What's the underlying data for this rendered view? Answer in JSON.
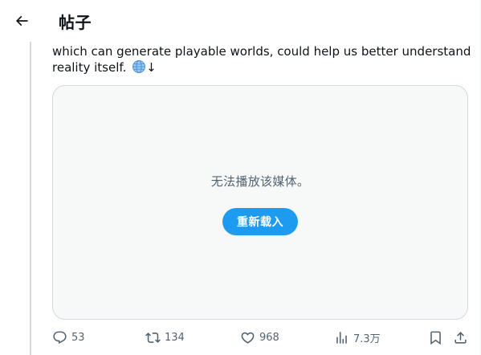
{
  "header": {
    "title": "帖子",
    "back_icon": "arrow-left-icon"
  },
  "tweet": {
    "text_line1": "which can generate playable worlds, could help us better understand",
    "text_line2": "reality itself. ",
    "emoji": "globe-icon",
    "arrow": "↓"
  },
  "media": {
    "error_message": "无法播放该媒体。",
    "reload_label": "重新载入"
  },
  "actions": {
    "replies": "53",
    "reposts": "134",
    "likes": "968",
    "views": "7.3万"
  },
  "colors": {
    "accent": "#1d9bf0",
    "secondary_text": "#536471",
    "border": "#cfd9de"
  }
}
